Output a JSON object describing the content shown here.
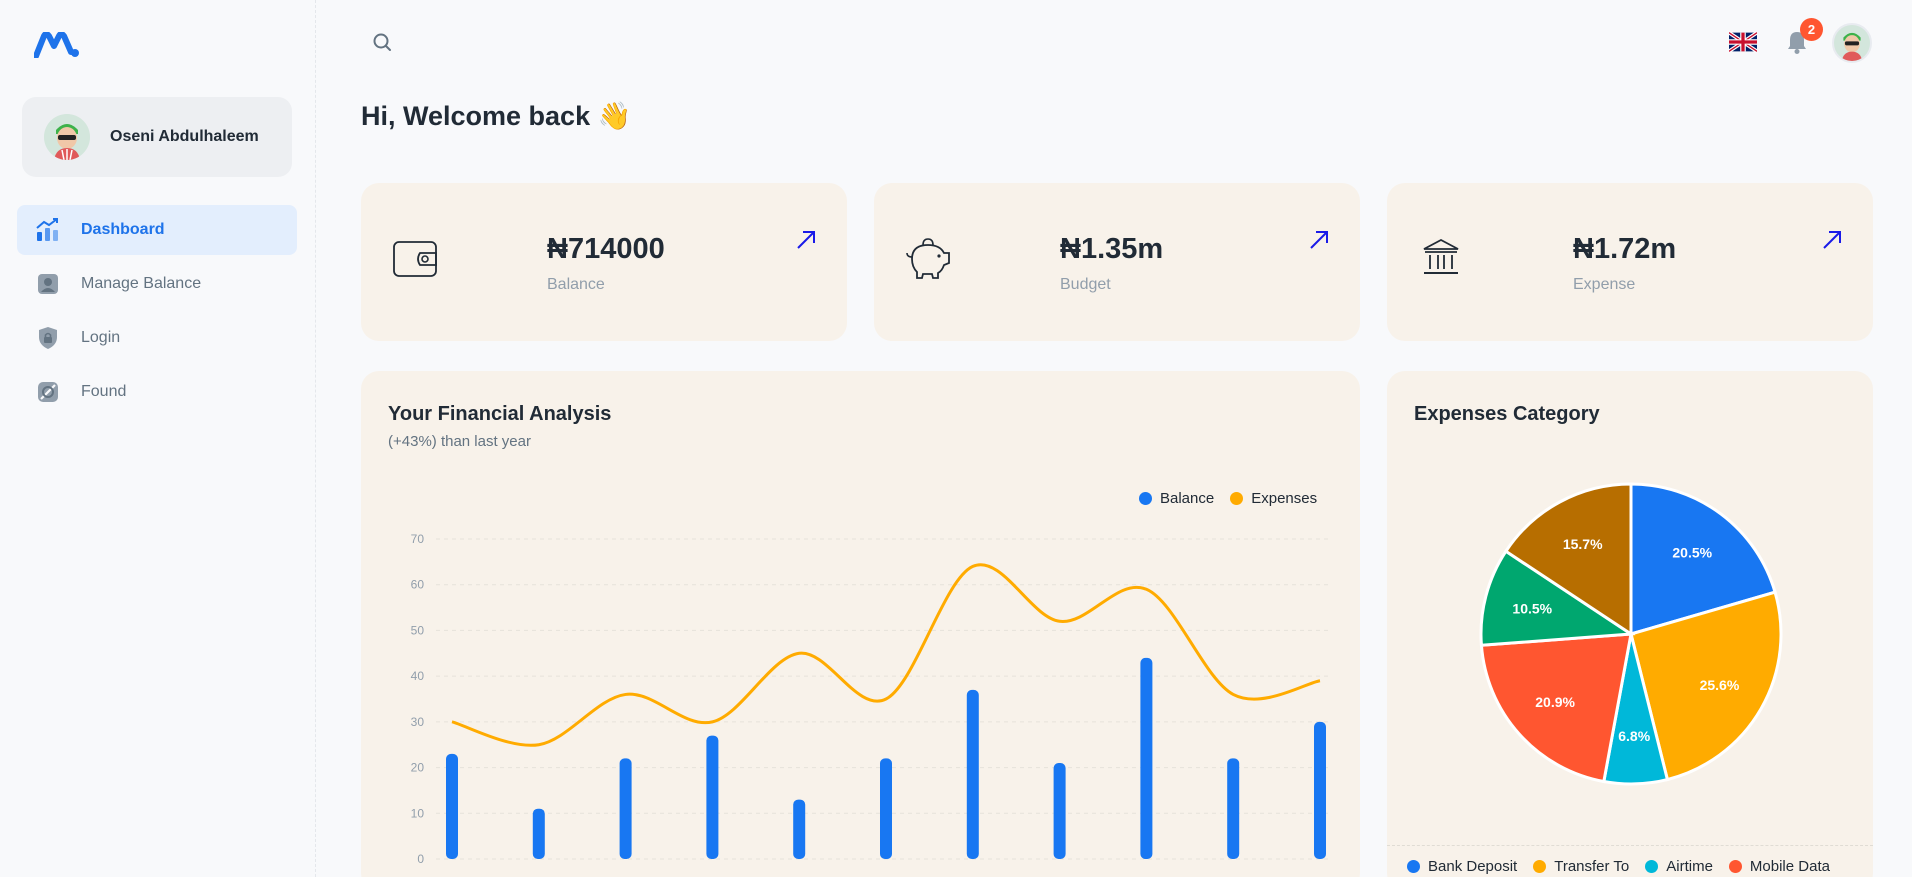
{
  "sidebar": {
    "user_name": "Oseni Abdulhaleem",
    "items": [
      {
        "label": "Dashboard",
        "icon": "chart-icon",
        "active": true
      },
      {
        "label": "Manage Balance",
        "icon": "user-icon",
        "active": false
      },
      {
        "label": "Login",
        "icon": "lock-icon",
        "active": false
      },
      {
        "label": "Found",
        "icon": "disabled-icon",
        "active": false
      }
    ]
  },
  "header": {
    "notification_count": "2"
  },
  "main": {
    "welcome": "Hi, Welcome back 👋",
    "stats": [
      {
        "value": "₦714000",
        "label": "Balance",
        "icon": "wallet-icon"
      },
      {
        "value": "₦1.35m",
        "label": "Budget",
        "icon": "piggy-bank-icon"
      },
      {
        "value": "₦1.72m",
        "label": "Expense",
        "icon": "bank-icon"
      }
    ],
    "analysis": {
      "title": "Your Financial Analysis",
      "subtitle": "(+43%) than last year"
    },
    "expenses": {
      "title": "Expenses Category"
    }
  },
  "colors": {
    "accent": "#1e73ea",
    "orange": "#ffab00",
    "card_bg": "#f8f2ea"
  },
  "chart_data": [
    {
      "type": "bar",
      "title": "Your Financial Analysis",
      "series": [
        {
          "name": "Balance",
          "type": "bar",
          "color": "#1877f2",
          "values": [
            23,
            11,
            22,
            27,
            13,
            22,
            37,
            21,
            44,
            22,
            30
          ]
        },
        {
          "name": "Expenses",
          "type": "line",
          "color": "#ffab00",
          "values": [
            30,
            25,
            36,
            30,
            45,
            35,
            64,
            52,
            59,
            36,
            39
          ]
        }
      ],
      "ylim": [
        0,
        70
      ],
      "yticks": [
        0,
        10,
        20,
        30,
        40,
        50,
        60,
        70
      ],
      "grid": true,
      "legend": "top-right"
    },
    {
      "type": "pie",
      "title": "Expenses Category",
      "slices": [
        {
          "label": "Bank Deposit",
          "value": 20.5,
          "color": "#1877f2"
        },
        {
          "label": "Transfer To",
          "value": 25.6,
          "color": "#ffab00"
        },
        {
          "label": "Airtime",
          "value": 6.8,
          "color": "#00b8d9"
        },
        {
          "label": "Mobile Data",
          "value": 20.9,
          "color": "#ff5630"
        },
        {
          "label": "",
          "value": 10.5,
          "color": "#00a76f"
        },
        {
          "label": "",
          "value": 15.7,
          "color": "#b76e00"
        }
      ],
      "legend": "bottom"
    }
  ]
}
